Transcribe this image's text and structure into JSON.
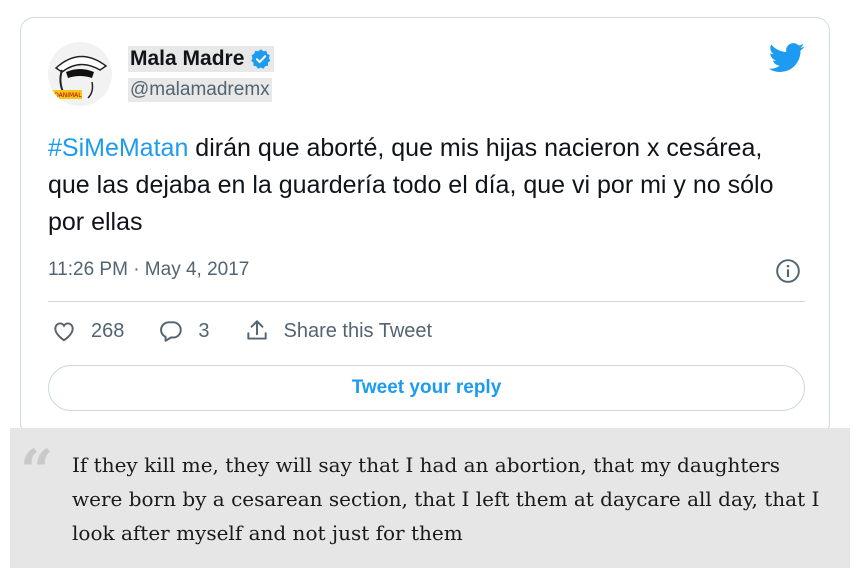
{
  "tweet": {
    "display_name": "Mala Madre",
    "handle": "@malamadremx",
    "hashtag": "#SiMeMatan",
    "text_rest": " dirán que aborté, que mis hijas nacieron x cesárea, que las dejaba en la guardería todo el día, que vi por mi y no sólo por ellas",
    "timestamp": "11:26 PM · May 4, 2017",
    "likes": "268",
    "replies": "3",
    "share_label": "Share this Tweet",
    "reply_button_label": "Tweet your reply"
  },
  "quote": {
    "mark": "“",
    "text": "If they kill me, they will say that I had an abortion, that my daughters were born by a cesarean section, that I left them at daycare all day, that I look after myself and not just for them"
  },
  "icons": {
    "verified": "verified-badge-icon",
    "brand": "twitter-bird-icon",
    "info": "info-icon",
    "like": "heart-icon",
    "reply": "reply-bubble-icon",
    "share": "share-icon"
  },
  "colors": {
    "accent": "#1d9bf0",
    "text": "#0f1419",
    "secondary": "#536471",
    "border": "#cfd9de",
    "quote_bg": "#e6e6e6"
  }
}
